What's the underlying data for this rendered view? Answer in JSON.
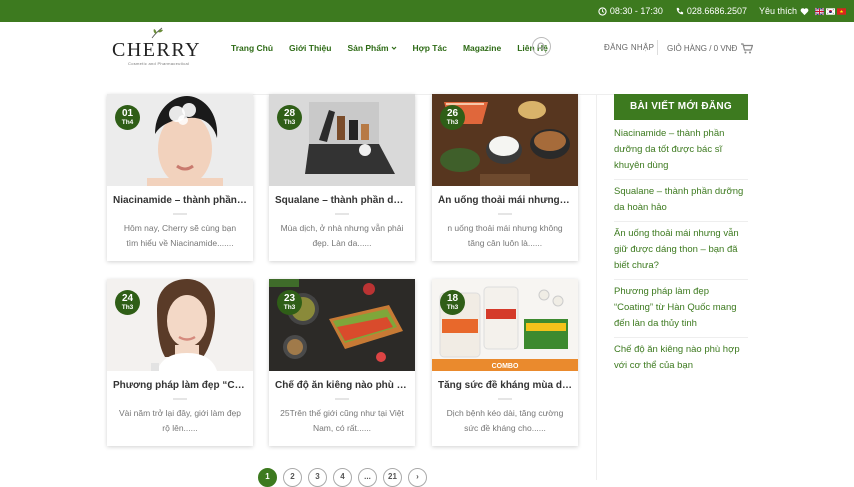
{
  "topbar": {
    "hours": "08:30 - 17:30",
    "phone": "028.6686.2507",
    "wishlist": "Yêu thích"
  },
  "brand": {
    "name": "CHERRY",
    "tagline": "Cosmetic and Pharmaceutical"
  },
  "nav": {
    "items": [
      "Trang Chủ",
      "Giới Thiệu",
      "Sản Phẩm",
      "Hợp Tác",
      "Magazine",
      "Liên Hệ"
    ],
    "login": "ĐĂNG NHẬP",
    "cart": "GIỎ HÀNG / 0 VNĐ"
  },
  "posts": [
    {
      "day": "01",
      "month": "Th4",
      "title": "Niacinamide – thành phần dưỡng da tốt được bác sĩ khuyên dùng",
      "excerpt": "Hôm nay, Cherry sẽ cùng bạn tìm hiểu về Niacinamide......."
    },
    {
      "day": "28",
      "month": "Th3",
      "title": "Squalane – thành phần dưỡng da hoàn hảo",
      "excerpt": "Mùa dịch, ở nhà nhưng vẫn phải đẹp. Làn da......"
    },
    {
      "day": "26",
      "month": "Th3",
      "title": "Ăn uống thoải mái nhưng vẫn giữ được dáng thon",
      "excerpt": "n uống thoải mái nhưng không tăng cân luôn là......"
    },
    {
      "day": "24",
      "month": "Th3",
      "title": "Phương pháp làm đẹp “Coating” từ Hàn Quốc",
      "excerpt": "Vài năm trở lại đây, giới làm đẹp rộ lên......"
    },
    {
      "day": "23",
      "month": "Th3",
      "title": "Chế độ ăn kiêng nào phù hợp với cơ thể của bạn",
      "excerpt": "25Trên thế giới cũng như tại Việt Nam, có rất......"
    },
    {
      "day": "18",
      "month": "Th3",
      "title": "Tăng sức đề kháng mùa dịch bệnh",
      "excerpt": "Dịch bệnh kéo dài, tăng cường sức đề kháng cho......"
    }
  ],
  "sidebar": {
    "heading": "BÀI VIẾT MỚI ĐĂNG",
    "posts": [
      "Niacinamide – thành phần dưỡng da tốt được bác sĩ khuyên dùng",
      "Squalane – thành phần dưỡng da hoàn hảo",
      "Ăn uống thoải mái nhưng vẫn giữ được dáng thon – bạn đã biết chưa?",
      "Phương pháp làm đẹp “Coating” từ Hàn Quốc mang đến làn da thủy tinh",
      "Chế độ ăn kiêng nào phù hợp với cơ thể của bạn"
    ]
  },
  "pagination": [
    "1",
    "2",
    "3",
    "4",
    "...",
    "21",
    "›"
  ],
  "colors": {
    "brand_green": "#3d7a1f",
    "badge_green": "#2f5e17"
  }
}
